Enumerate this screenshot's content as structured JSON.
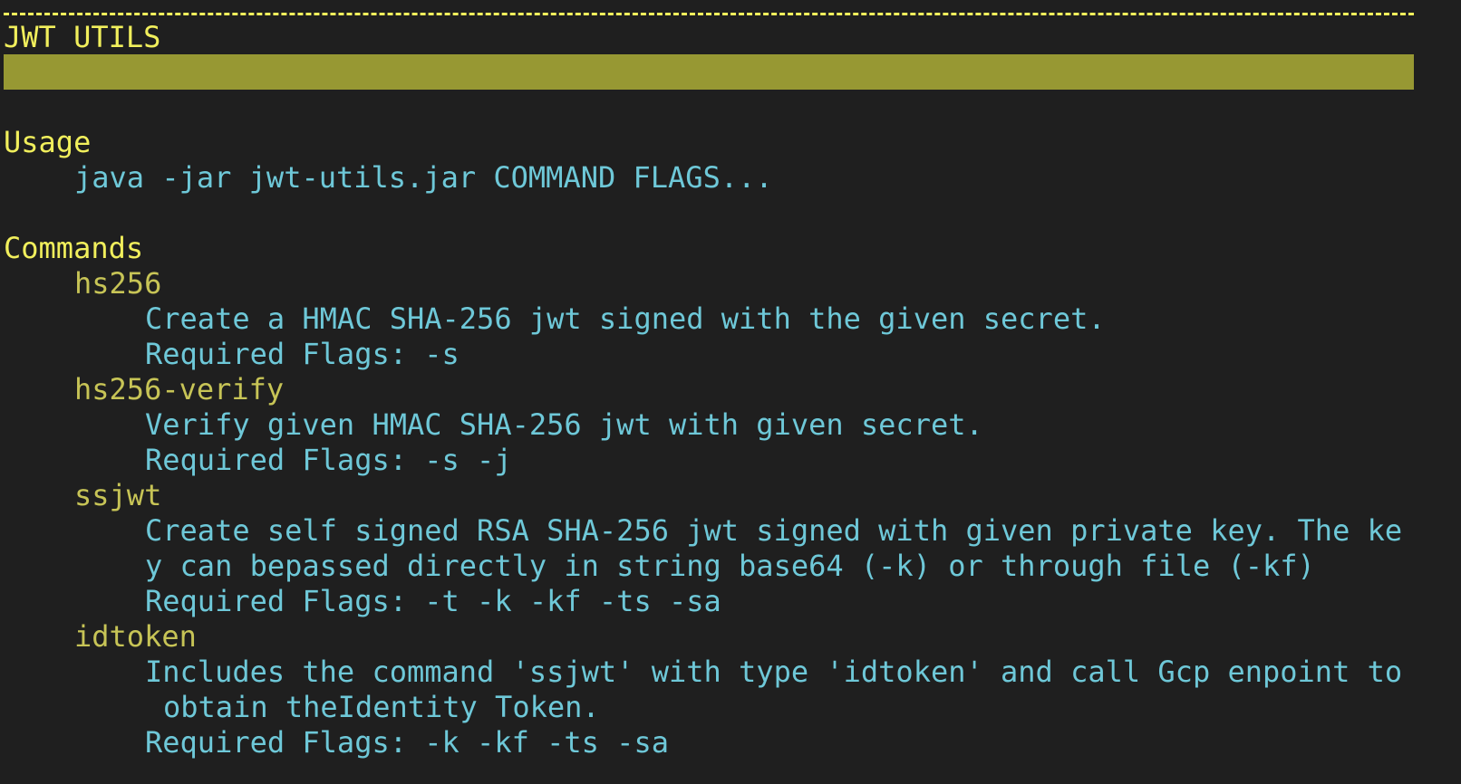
{
  "header": {
    "rule": "-------------------------------------------------------------------------------",
    "title": "JWT UTILS"
  },
  "usage": {
    "heading": "Usage",
    "line": "java -jar jwt-utils.jar COMMAND FLAGS..."
  },
  "commands": {
    "heading": "Commands",
    "items": [
      {
        "name": "hs256",
        "desc_lines": [
          "Create a HMAC SHA-256 jwt signed with the given secret."
        ],
        "flags": "Required Flags: -s"
      },
      {
        "name": "hs256-verify",
        "desc_lines": [
          "Verify given HMAC SHA-256 jwt with given secret."
        ],
        "flags": "Required Flags: -s -j"
      },
      {
        "name": "ssjwt",
        "desc_lines": [
          "Create self signed RSA SHA-256 jwt signed with given private key. The ke",
          "y can bepassed directly in string base64 (-k) or through file (-kf)"
        ],
        "flags": "Required Flags: -t -k -kf -ts -sa"
      },
      {
        "name": "idtoken",
        "desc_lines": [
          "Includes the command 'ssjwt' with type 'idtoken' and call Gcp enpoint to",
          "obtain theIdentity Token."
        ],
        "flags": "Required Flags: -k -kf -ts -sa"
      }
    ]
  },
  "colors": {
    "background": "#1f1f1f",
    "heading_yellow": "#f1ef5c",
    "command_olive": "#c7c456",
    "text_cyan": "#6ec8d8",
    "banner": "#979833"
  }
}
